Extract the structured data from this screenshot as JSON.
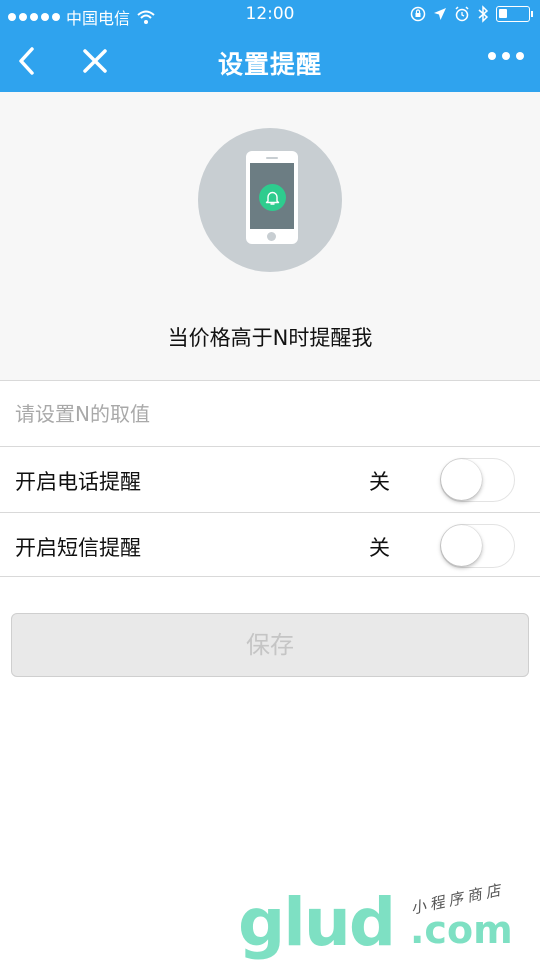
{
  "status_bar": {
    "carrier": "中国电信",
    "time": "12:00"
  },
  "nav": {
    "title": "设置提醒",
    "icons": {
      "back": "chevron-left-icon",
      "close": "close-icon",
      "more": "more-dots-icon"
    }
  },
  "hero": {
    "icon": "phone-bell-icon",
    "text": "当价格高于N时提醒我"
  },
  "form": {
    "n_input": {
      "placeholder": "请设置N的取值",
      "value": ""
    },
    "phone_reminder": {
      "label": "开启电话提醒",
      "state_text": "关",
      "enabled": false
    },
    "sms_reminder": {
      "label": "开启短信提醒",
      "state_text": "关",
      "enabled": false
    }
  },
  "save_button": {
    "label": "保存"
  },
  "watermark": {
    "logo": "glud",
    "tagline": "小程序商店",
    "suffix": ".com"
  },
  "colors": {
    "brand_blue": "#2fa3ee",
    "bell_green": "#2ecc8e",
    "watermark_green": "#7ee0c3"
  }
}
